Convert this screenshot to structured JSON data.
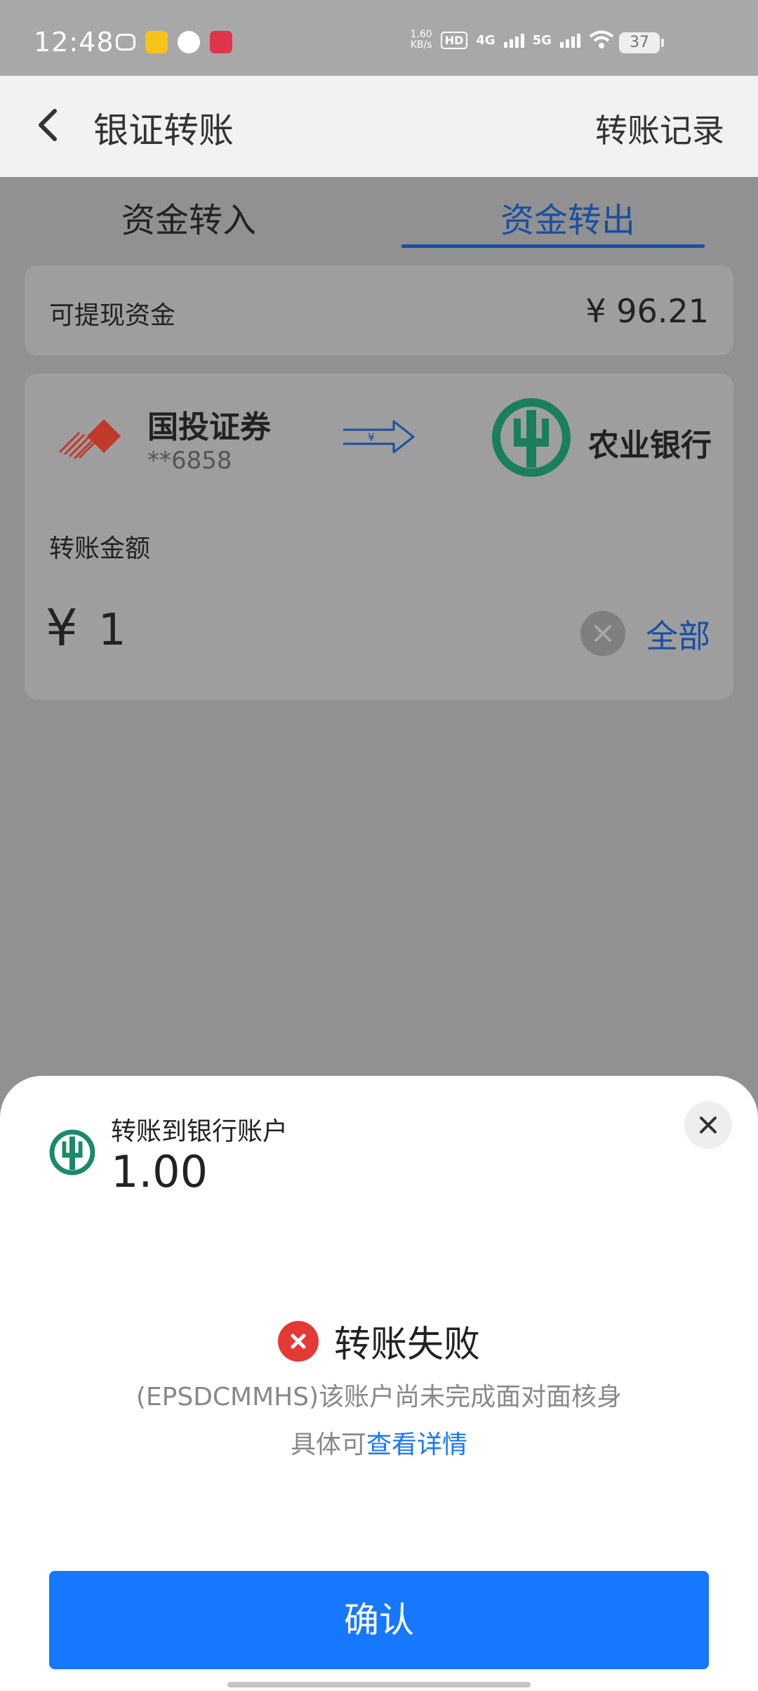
{
  "status_bar": {
    "time": "12:48",
    "speed_top": "1.60",
    "speed_bottom": "KB/s",
    "hd": "HD",
    "net1": "4G",
    "net2": "5G",
    "battery": "37"
  },
  "header": {
    "title": "银证转账",
    "records_label": "转账记录"
  },
  "tabs": [
    {
      "label": "资金转入",
      "active": false
    },
    {
      "label": "资金转出",
      "active": true
    }
  ],
  "balance": {
    "label": "可提现资金",
    "value": "¥ 96.21"
  },
  "transfer": {
    "from_name": "国投证券",
    "from_account": "**6858",
    "arrow_symbol": "¥",
    "to_name": "农业银行",
    "amount_label": "转账金额",
    "currency_symbol": "¥",
    "amount": "1",
    "all_label": "全部"
  },
  "result_sheet": {
    "label": "转账到银行账户",
    "amount": "1.00",
    "status_title": "转账失败",
    "message": "(EPSDCMMHS)该账户尚未完成面对面核身",
    "detail_prefix": "具体可",
    "detail_link": "查看详情",
    "confirm_label": "确认"
  },
  "colors": {
    "accent": "#1677ff",
    "tab_active": "#1a4fa3",
    "error": "#e53935",
    "bank_green": "#1a7f5a",
    "securities_red": "#c0392b"
  }
}
